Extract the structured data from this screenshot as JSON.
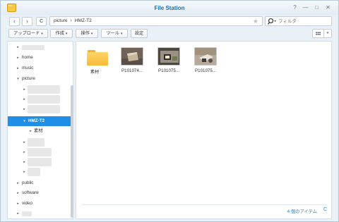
{
  "window": {
    "title": "File Station",
    "controls": {
      "help": "?",
      "minimize": "—",
      "maximize": "□",
      "close": "✕"
    }
  },
  "nav": {
    "back": "‹",
    "forward": "›",
    "refresh": "C"
  },
  "path": {
    "root": "picture",
    "current": "HMZ-T2",
    "separator": "›",
    "star": "★"
  },
  "filter": {
    "placeholder": "フィルタ"
  },
  "toolbar": {
    "upload": "アップロード",
    "create": "作成",
    "action": "操作",
    "tools": "ツール",
    "settings": "設定",
    "caret": "▾"
  },
  "tree": {
    "home": "home",
    "music": "music",
    "picture": "picture",
    "selected": "HMZ-T2",
    "subfolder": "素材",
    "public": "public",
    "software": "software",
    "video": "video",
    "expanded_arrow": "▾",
    "collapsed_arrow": "▸"
  },
  "files": [
    {
      "name": "素材",
      "type": "folder"
    },
    {
      "name": "P101074...",
      "type": "image"
    },
    {
      "name": "P101075...",
      "type": "image"
    },
    {
      "name": "P101075...",
      "type": "image"
    }
  ],
  "status": {
    "count": "4 個のアイテム",
    "refresh": "C"
  },
  "colors": {
    "accent": "#1e8fe6",
    "title": "#1e6fb0",
    "folder": "#f7bb35"
  }
}
